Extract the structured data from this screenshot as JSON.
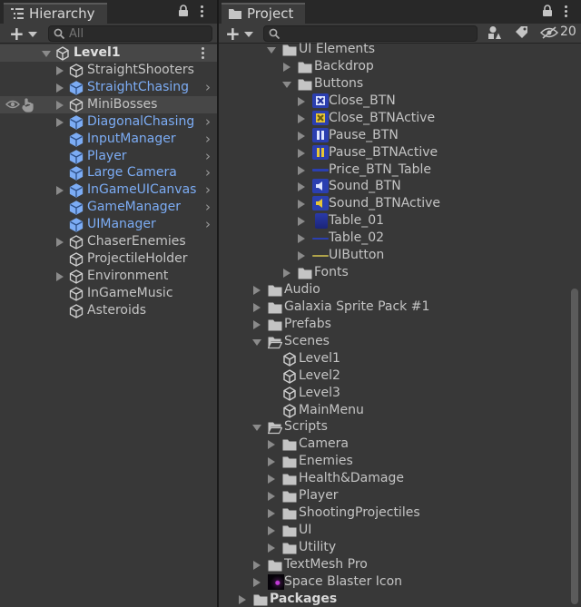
{
  "hierarchy": {
    "tab_label": "Hierarchy",
    "search_placeholder": "All",
    "scene_name": "Level1",
    "items": [
      {
        "label": "StraightShooters",
        "prefab": false,
        "children": true,
        "arrow": false
      },
      {
        "label": "StraightChasing",
        "prefab": true,
        "children": true,
        "arrow": true
      },
      {
        "label": "MiniBosses",
        "prefab": false,
        "children": true,
        "arrow": false
      },
      {
        "label": "DiagonalChasing",
        "prefab": true,
        "children": true,
        "arrow": true
      },
      {
        "label": "InputManager",
        "prefab": true,
        "children": false,
        "arrow": true
      },
      {
        "label": "Player",
        "prefab": true,
        "children": false,
        "arrow": true
      },
      {
        "label": "Large Camera",
        "prefab": true,
        "children": false,
        "arrow": true
      },
      {
        "label": "InGameUICanvas",
        "prefab": true,
        "children": true,
        "arrow": true
      },
      {
        "label": "GameManager",
        "prefab": true,
        "children": false,
        "arrow": true
      },
      {
        "label": "UIManager",
        "prefab": true,
        "children": false,
        "arrow": true
      },
      {
        "label": "ChaserEnemies",
        "prefab": false,
        "children": true,
        "arrow": false
      },
      {
        "label": "ProjectileHolder",
        "prefab": false,
        "children": false,
        "arrow": false
      },
      {
        "label": "Environment",
        "prefab": false,
        "children": true,
        "arrow": false
      },
      {
        "label": "InGameMusic",
        "prefab": false,
        "children": false,
        "arrow": false
      },
      {
        "label": "Asteroids",
        "prefab": false,
        "children": false,
        "arrow": false
      }
    ]
  },
  "project": {
    "tab_label": "Project",
    "hidden_count": "20",
    "items": [
      {
        "label": "UI Elements",
        "depth": 2,
        "kind": "folder",
        "expand": "down"
      },
      {
        "label": "Backdrop",
        "depth": 3,
        "kind": "folder",
        "expand": "right"
      },
      {
        "label": "Buttons",
        "depth": 3,
        "kind": "folder",
        "expand": "down"
      },
      {
        "label": "Close_BTN",
        "depth": 4,
        "kind": "sprite",
        "sprite": "close",
        "expand": "right"
      },
      {
        "label": "Close_BTNActive",
        "depth": 4,
        "kind": "sprite",
        "sprite": "close-active",
        "expand": "right"
      },
      {
        "label": "Pause_BTN",
        "depth": 4,
        "kind": "sprite",
        "sprite": "pause",
        "expand": "right"
      },
      {
        "label": "Pause_BTNActive",
        "depth": 4,
        "kind": "sprite",
        "sprite": "pause-active",
        "expand": "right"
      },
      {
        "label": "Price_BTN_Table",
        "depth": 4,
        "kind": "sprite",
        "sprite": "price",
        "expand": "right"
      },
      {
        "label": "Sound_BTN",
        "depth": 4,
        "kind": "sprite",
        "sprite": "sound",
        "expand": "right"
      },
      {
        "label": "Sound_BTNActive",
        "depth": 4,
        "kind": "sprite",
        "sprite": "sound-active",
        "expand": "right"
      },
      {
        "label": "Table_01",
        "depth": 4,
        "kind": "sprite",
        "sprite": "table01",
        "expand": "right"
      },
      {
        "label": "Table_02",
        "depth": 4,
        "kind": "sprite",
        "sprite": "table02",
        "expand": "right"
      },
      {
        "label": "UIButton",
        "depth": 4,
        "kind": "sprite",
        "sprite": "uibutton",
        "expand": "right"
      },
      {
        "label": "Fonts",
        "depth": 3,
        "kind": "folder",
        "expand": "right"
      },
      {
        "label": "Audio",
        "depth": 1,
        "kind": "folder",
        "expand": "right"
      },
      {
        "label": "Galaxia Sprite Pack #1",
        "depth": 1,
        "kind": "folder",
        "expand": "right"
      },
      {
        "label": "Prefabs",
        "depth": 1,
        "kind": "folder",
        "expand": "right"
      },
      {
        "label": "Scenes",
        "depth": 1,
        "kind": "folder-open",
        "expand": "down"
      },
      {
        "label": "Level1",
        "depth": 2,
        "kind": "scene",
        "expand": ""
      },
      {
        "label": "Level2",
        "depth": 2,
        "kind": "scene",
        "expand": ""
      },
      {
        "label": "Level3",
        "depth": 2,
        "kind": "scene",
        "expand": ""
      },
      {
        "label": "MainMenu",
        "depth": 2,
        "kind": "scene",
        "expand": ""
      },
      {
        "label": "Scripts",
        "depth": 1,
        "kind": "folder-open",
        "expand": "down"
      },
      {
        "label": "Camera",
        "depth": 2,
        "kind": "folder",
        "expand": "right"
      },
      {
        "label": "Enemies",
        "depth": 2,
        "kind": "folder",
        "expand": "right"
      },
      {
        "label": "Health&Damage",
        "depth": 2,
        "kind": "folder",
        "expand": "right"
      },
      {
        "label": "Player",
        "depth": 2,
        "kind": "folder",
        "expand": "right"
      },
      {
        "label": "ShootingProjectiles",
        "depth": 2,
        "kind": "folder",
        "expand": "right"
      },
      {
        "label": "UI",
        "depth": 2,
        "kind": "folder",
        "expand": "right"
      },
      {
        "label": "Utility",
        "depth": 2,
        "kind": "folder",
        "expand": "right"
      },
      {
        "label": "TextMesh Pro",
        "depth": 1,
        "kind": "folder",
        "expand": "right"
      },
      {
        "label": "Space Blaster Icon",
        "depth": 1,
        "kind": "image",
        "expand": "right"
      },
      {
        "label": "Packages",
        "depth": 0,
        "kind": "folder",
        "expand": "right",
        "bold": true
      }
    ]
  },
  "colors": {
    "prefab_text": "#7cacf4",
    "folder": "#c4c4c4",
    "sprite_blue": "#2b3fb0",
    "sprite_yellow": "#e7c636"
  }
}
